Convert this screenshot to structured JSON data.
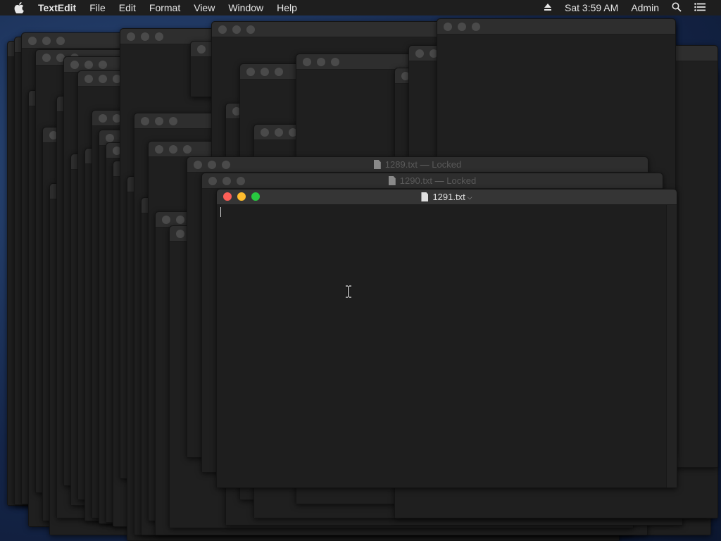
{
  "menubar": {
    "app_name": "TextEdit",
    "items": [
      "File",
      "Edit",
      "Format",
      "View",
      "Window",
      "Help"
    ],
    "clock": "Sat 3:59 AM",
    "user": "Admin",
    "icons": [
      "apple-icon",
      "eject-icon",
      "spotlight-search-icon",
      "notification-center-icon"
    ]
  },
  "windows": {
    "w1289": {
      "filename": "1289.txt",
      "status": "Locked",
      "separator": "—"
    },
    "w1290": {
      "filename": "1290.txt",
      "status": "Locked",
      "separator": "—"
    },
    "front": {
      "filename": "1291.txt",
      "document_text": ""
    }
  },
  "colors": {
    "close": "#fe5f57",
    "minimize": "#febc2e",
    "zoom": "#28c840",
    "window_bg": "#1e1e1e"
  }
}
